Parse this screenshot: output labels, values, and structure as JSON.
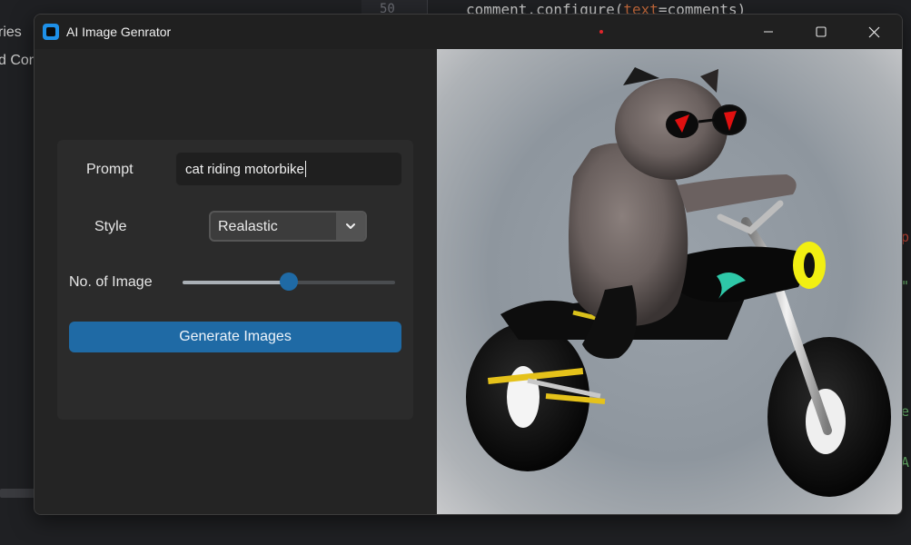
{
  "background_editor": {
    "side_text_1": "ries",
    "side_text_2": "d Cor",
    "line_number": "50",
    "code_line": {
      "prefix": "comment.configure(",
      "keyword": "text",
      "suffix": "=comments)"
    },
    "right_chars": [
      {
        "text": "p",
        "color": "#d04a3a"
      },
      {
        "text": "\"",
        "color": "#6fbf73"
      },
      {
        "text": "e",
        "color": "#6fbf73"
      },
      {
        "text": "A",
        "color": "#6fbf73"
      }
    ]
  },
  "window": {
    "title": "AI Image Genrator",
    "icons": {
      "app": "app-icon",
      "minimize": "minimize-icon",
      "maximize": "maximize-icon",
      "close": "close-icon"
    }
  },
  "form": {
    "prompt": {
      "label": "Prompt",
      "value": "cat riding motorbike"
    },
    "style": {
      "label": "Style",
      "selected": "Realastic",
      "arrow_icon": "chevron-down-icon"
    },
    "num_images": {
      "label": "No. of Image",
      "slider_fraction": 0.5
    },
    "generate_button": "Generate Images"
  },
  "image": {
    "subject": "generated-image",
    "accent_colors": {
      "seat_stripe": "#e5c21a",
      "lens": "#e01010",
      "swoosh": "#2ec8a8"
    }
  },
  "colors": {
    "accent": "#1f6aa5",
    "window_bg": "#242424",
    "panel_bg": "#2b2b2b"
  }
}
